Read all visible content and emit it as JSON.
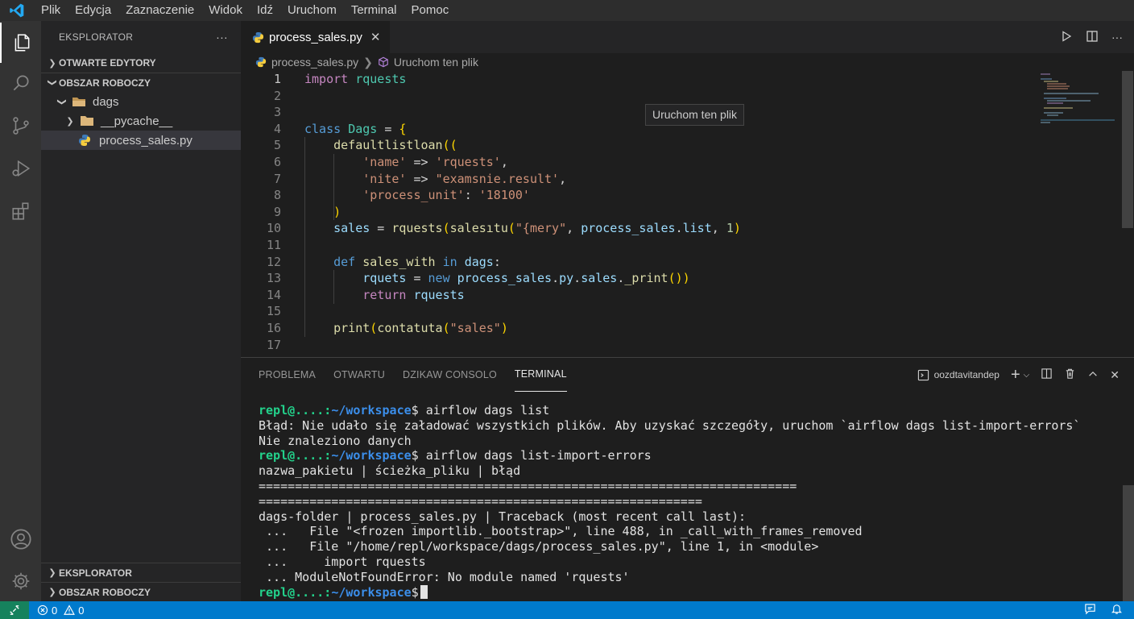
{
  "menu": [
    "Plik",
    "Edycja",
    "Zaznaczenie",
    "Widok",
    "Idź",
    "Uruchom",
    "Terminal",
    "Pomoc"
  ],
  "activity_icons": [
    "files-icon",
    "search-icon",
    "source-control-icon",
    "run-debug-icon",
    "extensions-icon",
    "account-icon",
    "settings-gear-icon"
  ],
  "sidebar": {
    "title": "EKSPLORATOR",
    "more": "···",
    "open_editors": "OTWARTE EDYTORY",
    "workspace": "OBSZAR ROBOCZY",
    "tree": {
      "folder": "dags",
      "pycache": "__pycache__",
      "file": "process_sales.py"
    },
    "bottom_sections": [
      "EKSPLORATOR",
      "OBSZAR ROBOCZY"
    ]
  },
  "editor": {
    "tab_label": "process_sales.py",
    "breadcrumb_file": "process_sales.py",
    "breadcrumb_symbol": "Uruchom ten plik",
    "tooltip": "Uruchom ten plik",
    "line_numbers": [
      "1",
      "2",
      "3",
      "4",
      "5",
      "6",
      "7",
      "8",
      "9",
      "10",
      "11",
      "12",
      "13",
      "14",
      "15",
      "16",
      "17"
    ]
  },
  "panel": {
    "tabs": [
      "PROBLEMA",
      "OTWARTU",
      "DZIKAW CONSOLO",
      "TERMINAL"
    ],
    "active_tab": "TERMINAL",
    "terminal_name": "oozdtavitandep",
    "prompt_user": "repl@....:",
    "prompt_path": "~/workspace",
    "prompt_sign": "$",
    "cmd1": " airflow dags list",
    "out1": "Błąd: Nie udało się załadować wszystkich plików. Aby uzyskać szczegóły, uruchom `airflow dags list-import-errors`",
    "out2": "Nie znaleziono danych",
    "cmd2": " airflow dags list-import-errors",
    "out3": "nazwa_pakietu | ścieżka_pliku | błąd",
    "sep1": "==========================================================================",
    "sep2": "=============================================================",
    "out4": "dags-folder | process_sales.py | Traceback (most recent call last):",
    "out5": " ...   File \"<frozen importlib._bootstrap>\", line 488, in _call_with_frames_removed",
    "out6": " ...   File \"/home/repl/workspace/dags/process_sales.py\", line 1, in <module>",
    "out7": " ...     import rquests",
    "out8": " ... ModuleNotFoundError: No module named 'rquests'"
  },
  "status": {
    "errors": "0",
    "warnings": "0"
  },
  "colors": {
    "statusbar": "#007acc",
    "activitybar": "#333333",
    "sidebar": "#252526",
    "editor": "#1e1e1e"
  }
}
